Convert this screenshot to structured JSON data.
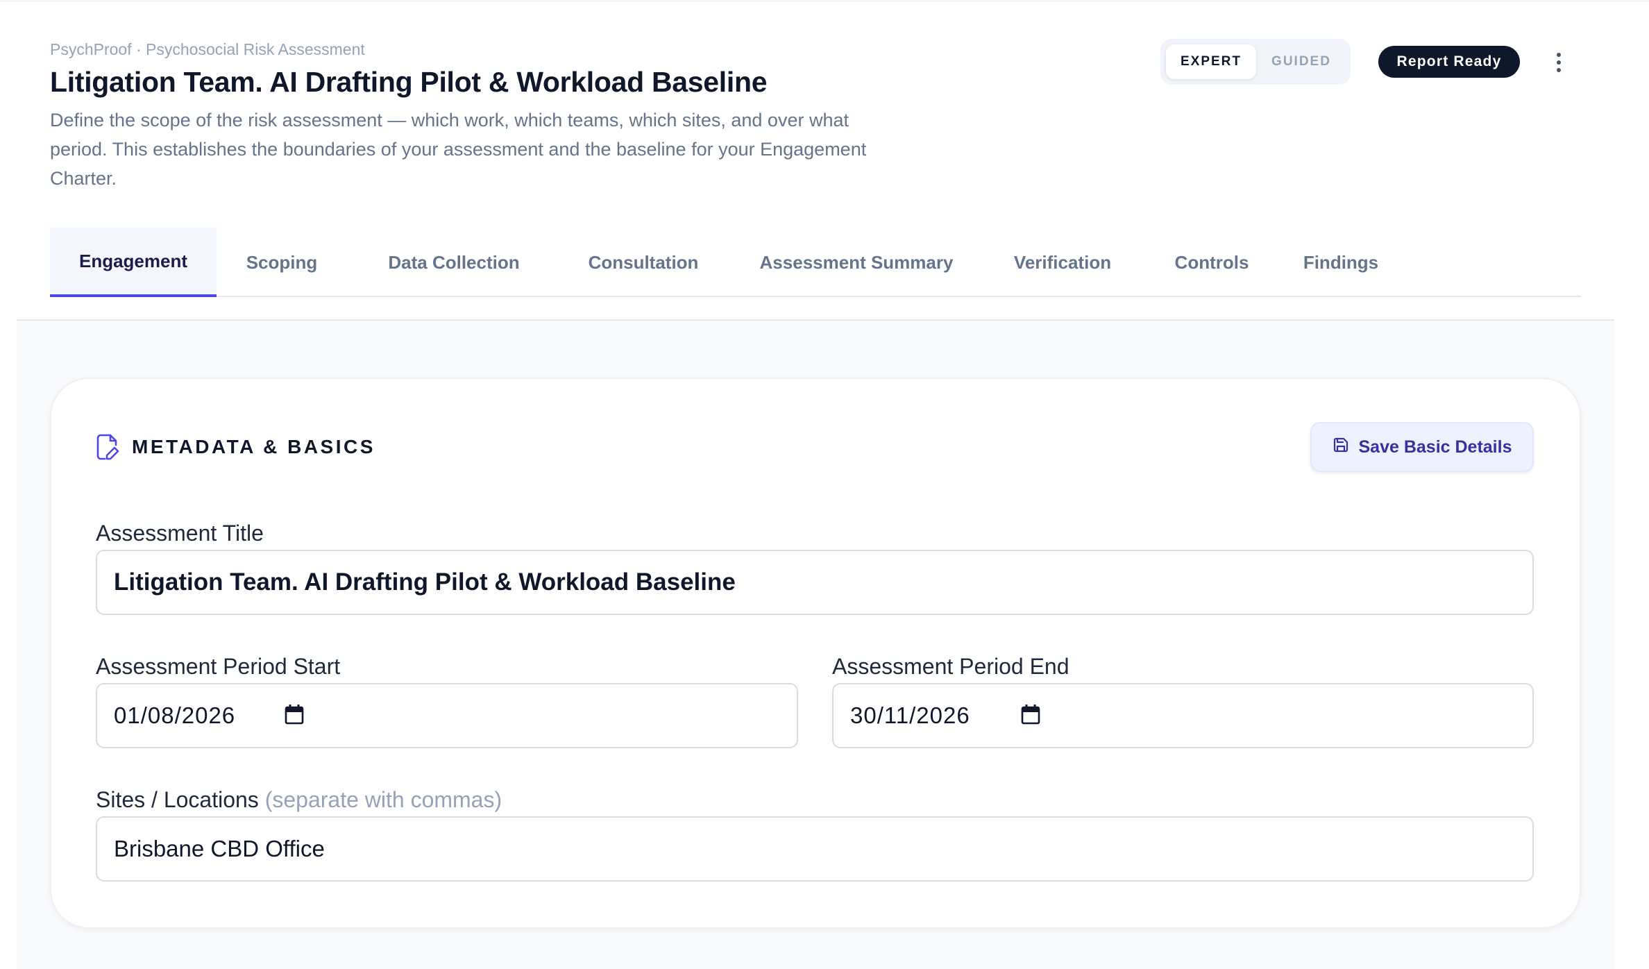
{
  "header": {
    "breadcrumb": "PsychProof · Psychosocial Risk Assessment",
    "title": "Litigation Team. AI Drafting Pilot & Workload Baseline",
    "description": "Define the scope of the risk assessment — which work, which teams, which sites, and over what period. This establishes the boundaries of your assessment and the baseline for your Engagement Charter.",
    "mode_toggle": {
      "options": [
        "EXPERT",
        "GUIDED"
      ],
      "selected": "EXPERT"
    },
    "status_badge": "Report Ready",
    "more_icon": "more-vertical-icon"
  },
  "tabs": [
    {
      "label": "Engagement",
      "active": true
    },
    {
      "label": "Scoping",
      "active": false
    },
    {
      "label": "Data Collection",
      "active": false
    },
    {
      "label": "Consultation",
      "active": false
    },
    {
      "label": "Assessment Summary",
      "active": false
    },
    {
      "label": "Verification",
      "active": false
    },
    {
      "label": "Controls",
      "active": false
    },
    {
      "label": "Findings",
      "active": false
    }
  ],
  "card": {
    "section_title": "METADATA & BASICS",
    "section_icon": "file-edit-icon",
    "save_button": {
      "label": "Save Basic Details",
      "icon": "save-icon"
    },
    "fields": {
      "title": {
        "label": "Assessment Title",
        "value": "Litigation Team. AI Drafting Pilot & Workload Baseline"
      },
      "period_start": {
        "label": "Assessment Period Start",
        "value": "01/08/2026"
      },
      "period_end": {
        "label": "Assessment Period End",
        "value": "30/11/2026"
      },
      "sites": {
        "label": "Sites / Locations",
        "hint": "(separate with commas)",
        "value": "Brisbane CBD Office"
      }
    }
  },
  "colors": {
    "accent": "#4f46e5",
    "text_primary": "#0f172a",
    "text_muted": "#64748b",
    "badge_bg": "#0f172a",
    "save_bg": "#eef2ff"
  }
}
